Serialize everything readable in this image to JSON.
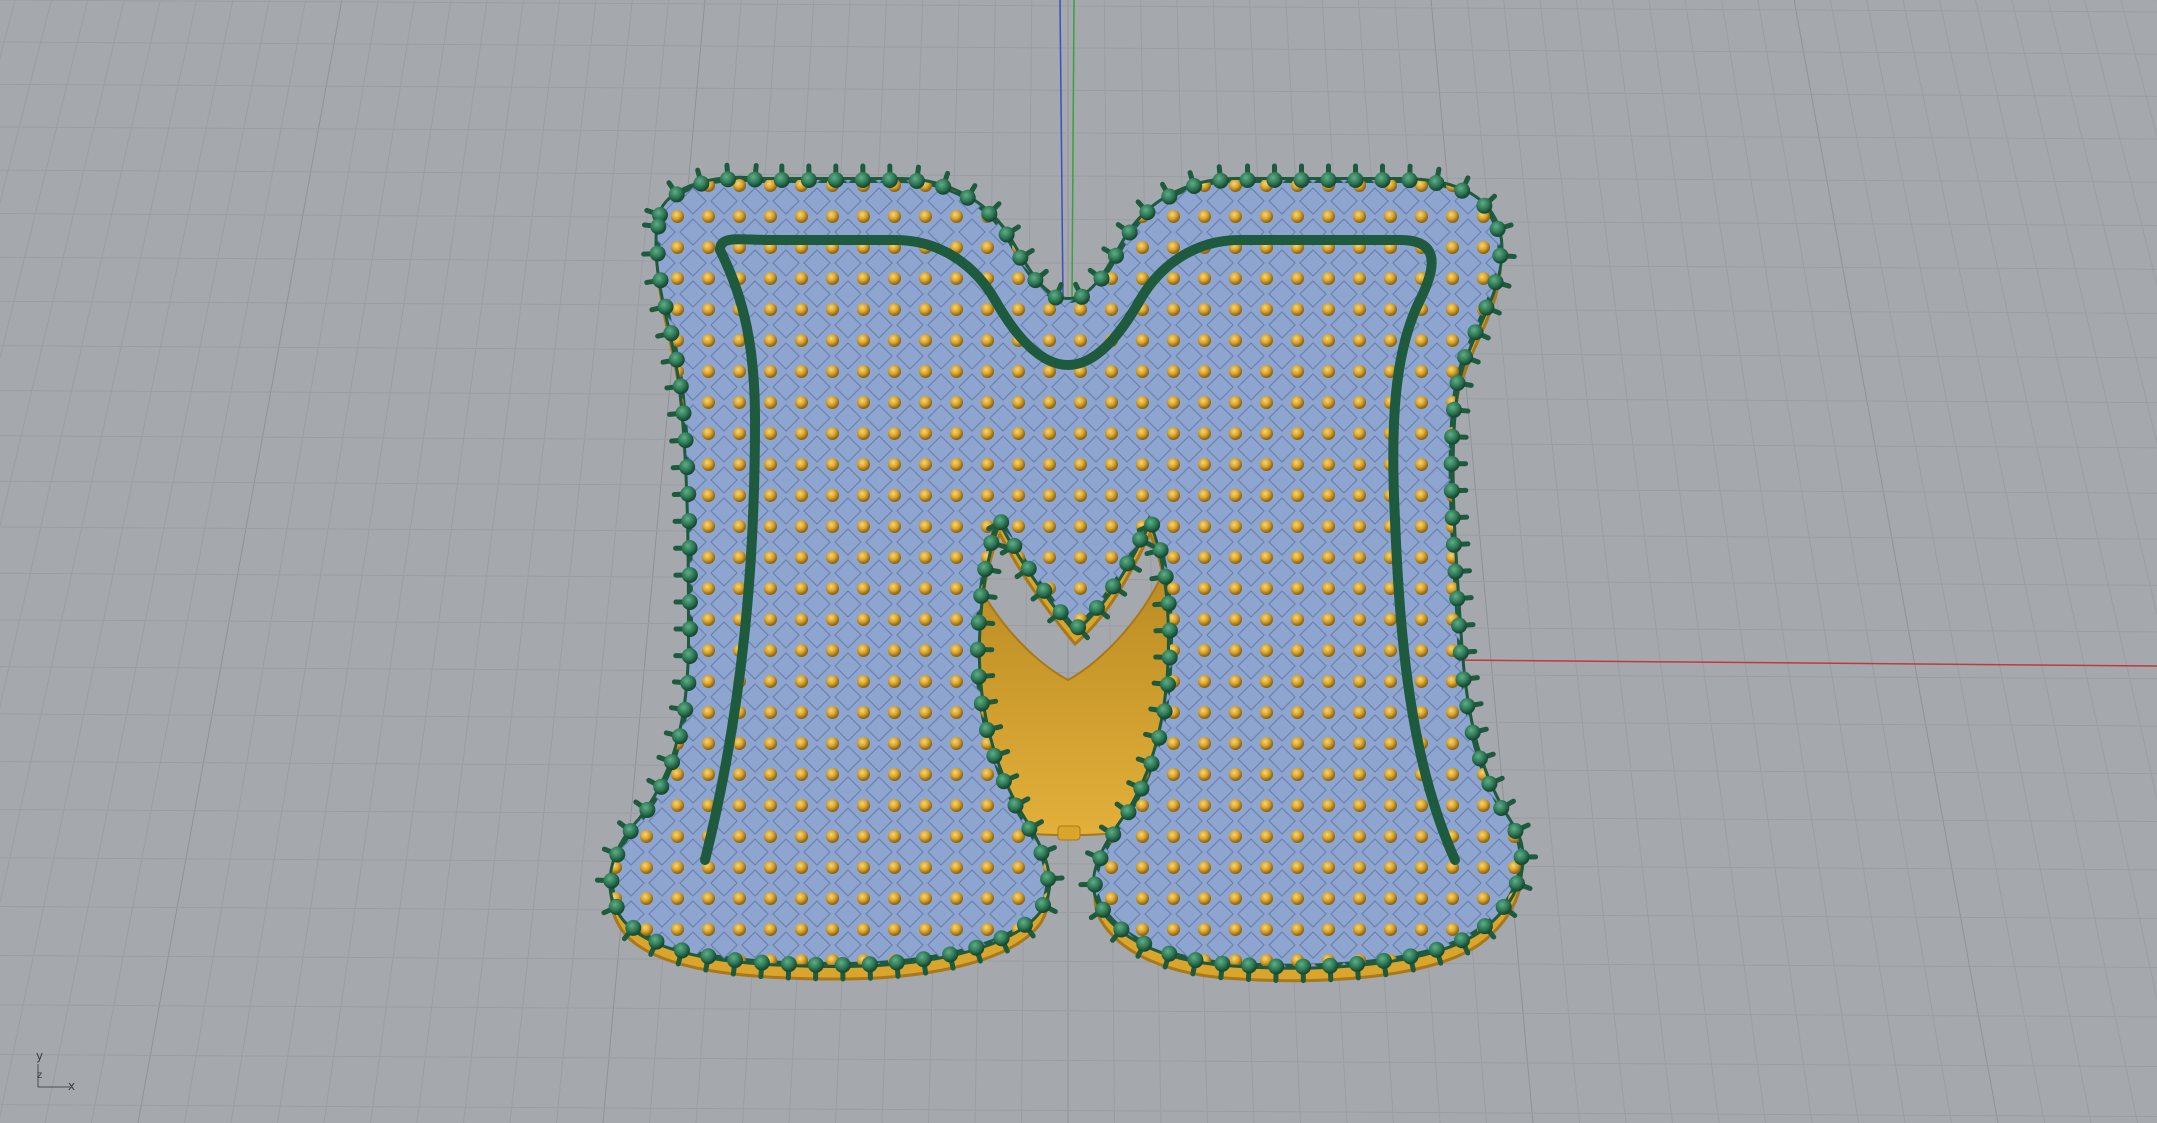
{
  "viewport": {
    "name": "Top",
    "background_color": "#a5a9ad",
    "grid_color": "#9a9ea2",
    "grid_major_color": "#8f9397"
  },
  "world_axes": {
    "x_axis_color": "#c0393b",
    "y_axis_color": "#3aa23a",
    "z_axis_color": "#3b4fc2"
  },
  "model": {
    "letter": "M",
    "colors": {
      "gold": "#d9a52c",
      "gold_dark": "#a8781a",
      "blue": "#8ea5cf",
      "blue_dark": "#6a82b0",
      "green": "#2f7a57",
      "green_dark": "#1d5a3e"
    }
  },
  "axis_widget": {
    "y_label": "y",
    "z_label": "z",
    "x_label": "x"
  }
}
